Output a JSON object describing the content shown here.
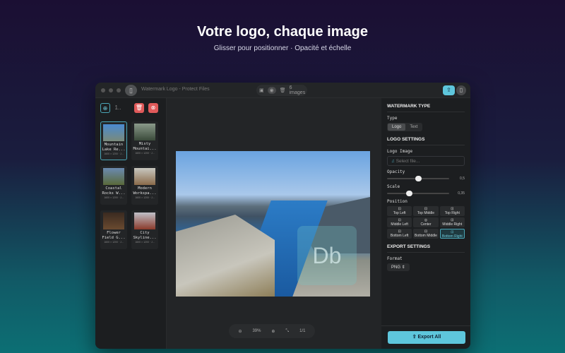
{
  "hero": {
    "title": "Votre logo, chaque image",
    "subtitle": "Glisser pour positionner · Opacité et échelle"
  },
  "window": {
    "title": "Watermark Logo - Protect Files",
    "image_count": "6 images"
  },
  "sidebar": {
    "count_label": "1..",
    "images": [
      {
        "name": "Mountain Lake Re...",
        "meta": "1600 × 1200 · J...",
        "selected": true
      },
      {
        "name": "Misty Mountai...",
        "meta": "1600 × 1200 · J..."
      },
      {
        "name": "Coastal Rocks W...",
        "meta": "1600 × 1200 · J..."
      },
      {
        "name": "Modern Workspa...",
        "meta": "1600 × 1200 · J..."
      },
      {
        "name": "Flower Field G...",
        "meta": "1600 × 1200 · J..."
      },
      {
        "name": "City Skyline...",
        "meta": "1600 × 1200 · J..."
      }
    ]
  },
  "canvas": {
    "watermark_glyph": "Db",
    "zoom": "39%",
    "page": "1/1"
  },
  "panel": {
    "watermark_type": "WATERMARK TYPE",
    "type_label": "Type",
    "type_options": [
      "Logo",
      "Text"
    ],
    "type_selected": "Logo",
    "logo_settings": "LOGO SETTINGS",
    "logo_image_label": "Logo Image",
    "logo_placeholder": "Select file...",
    "opacity_label": "Opacity",
    "opacity": 0.5,
    "opacity_text": "0,5",
    "scale_label": "Scale",
    "scale": 0.35,
    "scale_text": "0,35",
    "position_label": "Position",
    "positions": [
      "Top Left",
      "Top Middle",
      "Top Right",
      "Middle Left",
      "Center",
      "Middle Right",
      "Bottom Left",
      "Bottom Middle",
      "Bottom Right"
    ],
    "position_selected": "Bottom Right",
    "export_settings": "EXPORT SETTINGS",
    "format_label": "Format",
    "format": "PNG",
    "export_label": "Export All"
  },
  "colors": {
    "accent": "#5ec6dc",
    "danger": "#e05a5a"
  }
}
